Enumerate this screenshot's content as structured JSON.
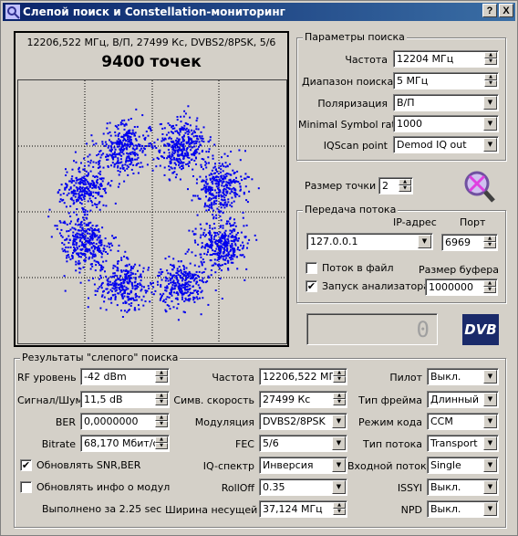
{
  "window": {
    "title": "Слепой поиск и Constellation-мониторинг",
    "help_btn": "?",
    "close_btn": "X"
  },
  "plot": {
    "subtitle": "12206,522 МГц, В/П, 27499 Кс, DVBS2/8PSK, 5/6",
    "count": "9400 точек"
  },
  "search_params": {
    "title": "Параметры поиска",
    "freq_label": "Частота",
    "freq_value": "12204 МГц",
    "range_label": "Диапазон поиска",
    "range_value": "5 МГц",
    "pol_label": "Поляризация",
    "pol_value": "В/П",
    "msr_label": "Minimal Symbol rate",
    "msr_value": "1000",
    "iq_label": "IQScan point",
    "iq_value": "Demod IQ out"
  },
  "point_size": {
    "label": "Размер точки",
    "value": "2"
  },
  "stream": {
    "title": "Передача потока",
    "ip_label": "IP-адрес",
    "port_label": "Порт",
    "ip_value": "127.0.0.1",
    "port_value": "6969",
    "to_file_label": "Поток в файл",
    "to_file_checked": false,
    "analyzer_label": "Запуск анализатора",
    "analyzer_checked": true,
    "buffer_label": "Размер буфера",
    "buffer_value": "1000000"
  },
  "lcd": {
    "value": "0"
  },
  "dvb_logo": "DVB",
  "results": {
    "title": "Результаты \"слепого\" поиска",
    "rf_label": "RF уровень",
    "rf_value": "-42 dBm",
    "snr_label": "Сигнал/Шум",
    "snr_value": "11,5 dB",
    "ber_label": "BER",
    "ber_value": "0,0000000",
    "bitrate_label": "Bitrate",
    "bitrate_value": "68,170 Мбит/с",
    "upd_snr_label": "Обновлять SNR,BER",
    "upd_snr_checked": true,
    "upd_mod_label": "Обновлять инфо о модуляции",
    "upd_mod_checked": false,
    "done_text": "Выполнено за 2.25 sec",
    "freq_label": "Частота",
    "freq_value": "12206,522 МГц",
    "sr_label": "Симв. скорость",
    "sr_value": "27499 Кс",
    "mod_label": "Модуляция",
    "mod_value": "DVBS2/8PSK",
    "fec_label": "FEC",
    "fec_value": "5/6",
    "iqs_label": "IQ-спектр",
    "iqs_value": "Инверсия",
    "rolloff_label": "RollOff",
    "rolloff_value": "0.35",
    "bw_label": "Ширина несущей",
    "bw_value": "37,124 МГц",
    "pilot_label": "Пилот",
    "pilot_value": "Выкл.",
    "frame_label": "Тип фрейма",
    "frame_value": "Длинный",
    "codemode_label": "Режим кода",
    "codemode_value": "CCM",
    "streamtype_label": "Тип потока",
    "streamtype_value": "Transport",
    "inputstream_label": "Входной поток",
    "inputstream_value": "Single",
    "issyi_label": "ISSYI",
    "issyi_value": "Выкл.",
    "npd_label": "NPD",
    "npd_value": "Выкл."
  },
  "colors": {
    "title_start": "#0a246a",
    "title_end": "#3a6ea5",
    "points": "#0000ee",
    "window_bg": "#d4d0c8"
  }
}
